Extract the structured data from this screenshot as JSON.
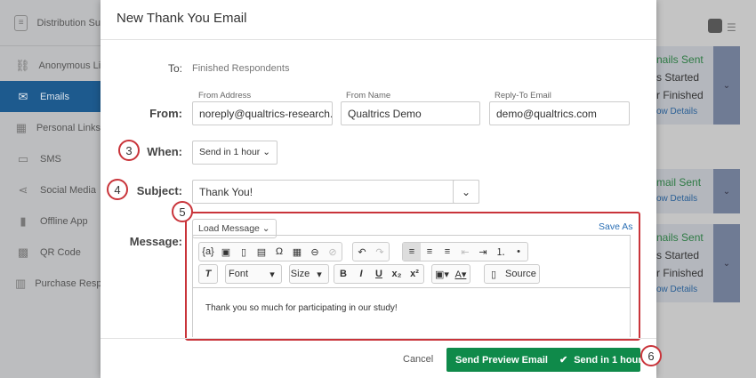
{
  "sidebar": {
    "header": "Distribution Su",
    "items": [
      {
        "label": "Anonymous Lin",
        "icon": "link-icon"
      },
      {
        "label": "Emails",
        "icon": "envelope-icon"
      },
      {
        "label": "Personal Links",
        "icon": "fingerprint-icon"
      },
      {
        "label": "SMS",
        "icon": "chat-bubble-icon"
      },
      {
        "label": "Social Media",
        "icon": "share-icon"
      },
      {
        "label": "Offline App",
        "icon": "tablet-icon"
      },
      {
        "label": "QR Code",
        "icon": "qr-code-icon"
      },
      {
        "label": "Purchase Resp",
        "icon": "register-icon"
      }
    ]
  },
  "cards": [
    {
      "lines": [
        "nails Sent",
        "s Started",
        "r Finished"
      ],
      "link": "ow Details"
    },
    {
      "lines": [
        "mail Sent"
      ],
      "link": "ow Details"
    },
    {
      "lines": [
        "nails Sent",
        "s Started",
        "r Finished"
      ],
      "link": "ow Details"
    }
  ],
  "modal": {
    "title": "New Thank You Email",
    "to_label": "To:",
    "to_value": "Finished Respondents",
    "from_label": "From:",
    "from_address_label": "From Address",
    "from_address": "noreply@qualtrics-research.",
    "from_name_label": "From Name",
    "from_name": "Qualtrics Demo",
    "reply_to_label": "Reply-To Email",
    "reply_to": "demo@qualtrics.com",
    "when_label": "When:",
    "when_value": "Send in 1 hour",
    "subject_label": "Subject:",
    "subject_value": "Thank You!",
    "message_label": "Message:",
    "load_message": "Load Message",
    "save_as": "Save As",
    "font": "Font",
    "size": "Size",
    "source": "Source",
    "body": "Thank you so much for participating in our study!",
    "cancel": "Cancel",
    "preview": "Send Preview Email",
    "send": "Send in 1 hour"
  },
  "badges": [
    "3",
    "4",
    "5",
    "6"
  ]
}
